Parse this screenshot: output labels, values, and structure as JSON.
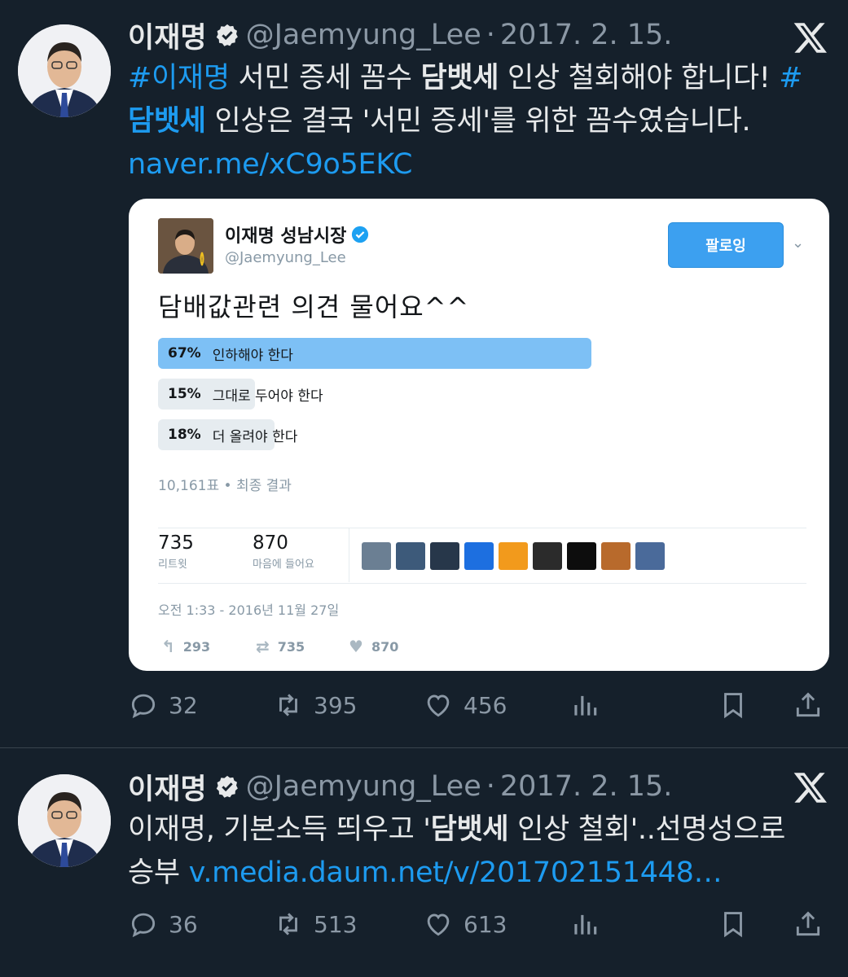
{
  "tweets": [
    {
      "author_name": "이재명",
      "handle": "@Jaemyung_Lee",
      "separator": "·",
      "date": "2017. 2. 15.",
      "body": [
        {
          "type": "link",
          "text": "#이재명"
        },
        {
          "type": "text",
          "text": " 서민 증세 꼼수 "
        },
        {
          "type": "strong",
          "text": "담뱃세"
        },
        {
          "type": "text",
          "text": " 인상 철회해야 합니다! "
        },
        {
          "type": "link",
          "text": "#"
        },
        {
          "type": "br"
        },
        {
          "type": "link-strong",
          "text": "담뱃세"
        },
        {
          "type": "text",
          "text": " 인상은 결국 '서민 증세'를 위한 꼼수였습니다."
        },
        {
          "type": "br"
        },
        {
          "type": "link",
          "text": "naver.me/xC9o5EKC"
        }
      ],
      "actions": {
        "replies": "32",
        "retweets": "395",
        "likes": "456"
      }
    },
    {
      "author_name": "이재명",
      "handle": "@Jaemyung_Lee",
      "separator": "·",
      "date": "2017. 2. 15.",
      "body": [
        {
          "type": "text",
          "text": "이재명, 기본소득 띄우고 '"
        },
        {
          "type": "strong",
          "text": "담뱃세"
        },
        {
          "type": "text",
          "text": " 인상 철회'..선명성으로"
        },
        {
          "type": "br"
        },
        {
          "type": "text",
          "text": "승부 "
        },
        {
          "type": "link",
          "text": "v.media.daum.net/v/201702151448…"
        }
      ],
      "actions": {
        "replies": "36",
        "retweets": "513",
        "likes": "613"
      }
    }
  ],
  "embedded": {
    "name": "이재명 성남시장",
    "handle": "@Jaemyung_Lee",
    "follow_label": "팔로잉",
    "text": "담배값관련 의견 물어요^^",
    "poll": [
      {
        "percent": "67%",
        "label": "인하해야 한다",
        "value": 67,
        "winner": true
      },
      {
        "percent": "15%",
        "label": "그대로 두어야 한다",
        "value": 15,
        "winner": false
      },
      {
        "percent": "18%",
        "label": "더 올려야 한다",
        "value": 18,
        "winner": false
      }
    ],
    "poll_meta": "10,161표 • 최종 결과",
    "retweets_count": "735",
    "retweets_label": "리트윗",
    "likes_count": "870",
    "likes_label": "마음에 들어요",
    "face_colors": [
      "#6b7f93",
      "#3d5a7a",
      "#27374a",
      "#1d6fe0",
      "#f29a1c",
      "#2b2b2b",
      "#0d0d0d",
      "#b86a2c",
      "#4a6a9a"
    ],
    "timestamp": "오전 1:33 - 2016년 11월 27일",
    "reply_count": "293",
    "retweet_count": "735",
    "like_count": "870"
  },
  "colors": {
    "background": "#15202b",
    "link": "#1d9bf0",
    "muted": "#8b98a5",
    "verified": "#e7e9ea",
    "poll_winner": "#7dc0f5",
    "follow_button": "#3ca0f0"
  }
}
